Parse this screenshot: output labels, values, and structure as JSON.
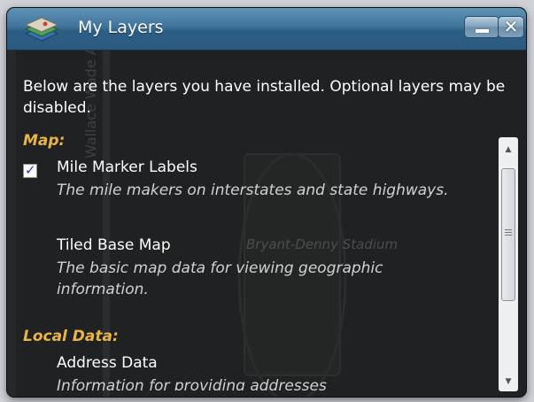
{
  "window": {
    "title": "My Layers",
    "minimize_icon": "minimize-icon",
    "close_icon": "close-icon",
    "close_glyph": "✕",
    "app_icon": "layers-icon"
  },
  "intro": "Below are the layers you have installed. Optional layers may be disabled.",
  "map_labels": {
    "street": "Wallace Wade Ave",
    "stadium": "Bryant-Denny Stadium"
  },
  "groups": [
    {
      "title": "Map:",
      "layers": [
        {
          "name": "Mile Marker Labels",
          "description": "The mile makers on interstates and state highways.",
          "has_checkbox": true,
          "checked": true
        },
        {
          "name": "Tiled Base Map",
          "description": "The basic map data for viewing geographic information.",
          "has_checkbox": false
        }
      ]
    },
    {
      "title": "Local Data:",
      "layers": [
        {
          "name": "Address Data",
          "description": "Information for providing addresses",
          "has_checkbox": false
        }
      ]
    }
  ],
  "scrollbar": {
    "up_icon": "scroll-up-arrow-icon",
    "down_icon": "scroll-down-arrow-icon",
    "up_glyph": "▲",
    "down_glyph": "▼"
  }
}
